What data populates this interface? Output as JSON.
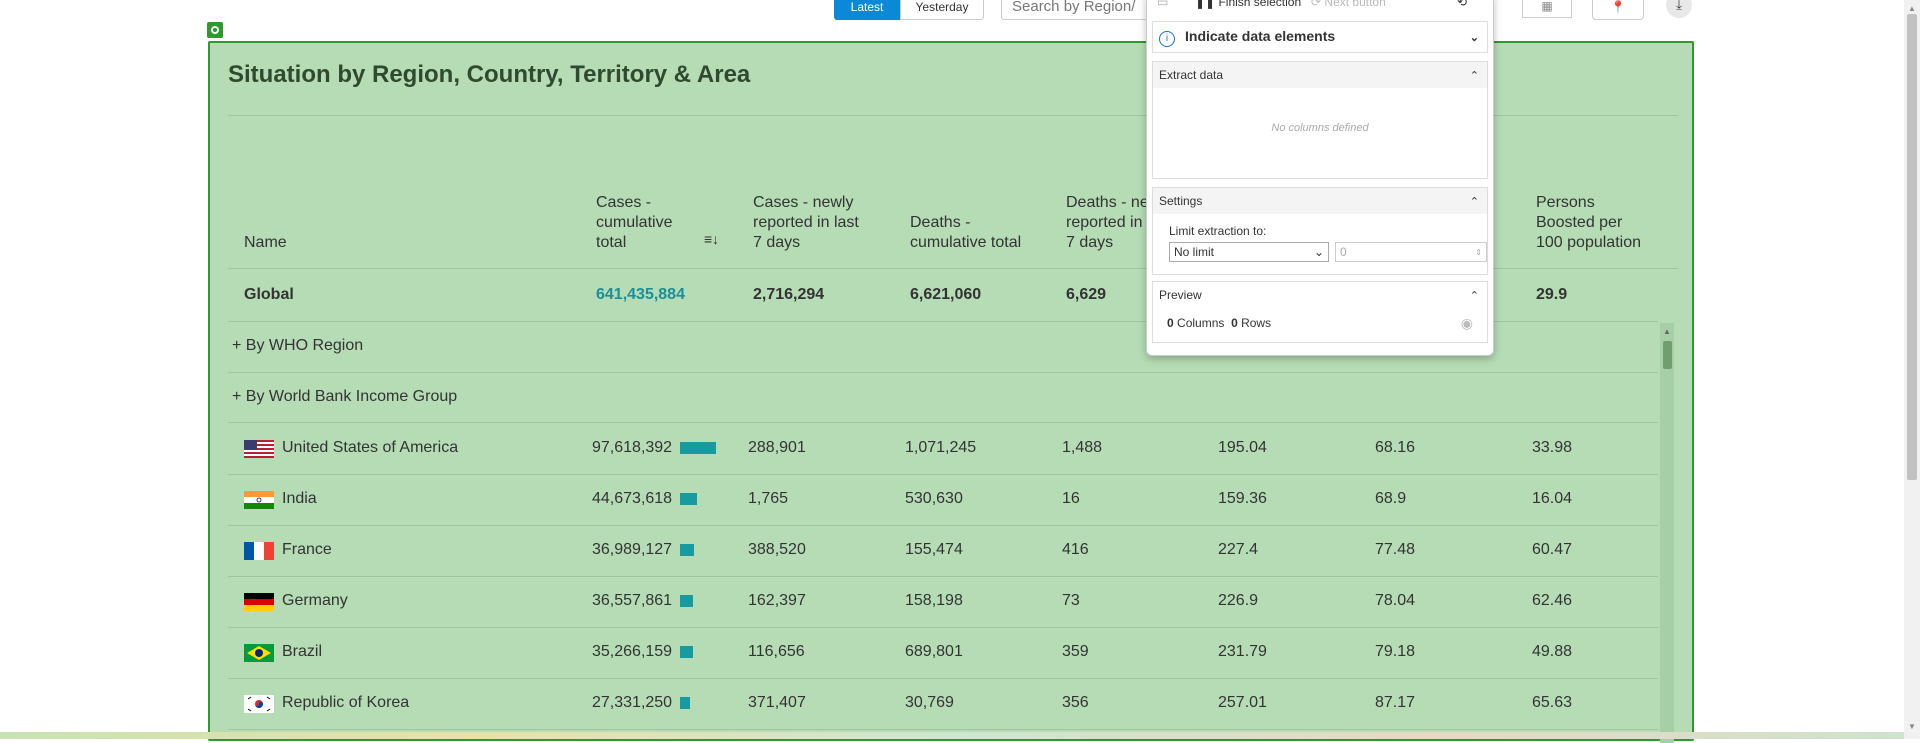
{
  "top_controls": {
    "latest_label": "Latest",
    "yesterday_label": "Yesterday",
    "search_placeholder": "Search by Region/"
  },
  "panel": {
    "title": "Situation by Region, Country, Territory & Area",
    "headers": {
      "name": "Name",
      "cases_total": [
        "Cases -",
        "cumulative",
        "total"
      ],
      "cases_new": [
        "Cases - newly",
        "reported in last",
        "7 days"
      ],
      "deaths_total": [
        "Deaths -",
        "cumulative total"
      ],
      "deaths_new": [
        "Deaths - ne",
        "reported in",
        "7 days"
      ],
      "boosted": [
        "Persons",
        "Boosted per",
        "100 population"
      ]
    },
    "global_row": {
      "name": "Global",
      "cases_total": "641,435,884",
      "cases_new": "2,716,294",
      "deaths_total": "6,621,060",
      "deaths_new": "6,629",
      "boosted": "29.9"
    },
    "groups": [
      "+ By WHO Region",
      "+ By World Bank Income Group"
    ],
    "countries": [
      {
        "name": "United States of America",
        "cases_total": "97,618,392",
        "bar": 1.0,
        "cases_new": "288,901",
        "deaths_total": "1,071,245",
        "deaths_new": "1,488",
        "col6": "195.04",
        "col7": "68.16",
        "boosted": "33.98"
      },
      {
        "name": "India",
        "cases_total": "44,673,618",
        "bar": 0.46,
        "cases_new": "1,765",
        "deaths_total": "530,630",
        "deaths_new": "16",
        "col6": "159.36",
        "col7": "68.9",
        "boosted": "16.04"
      },
      {
        "name": "France",
        "cases_total": "36,989,127",
        "bar": 0.38,
        "cases_new": "388,520",
        "deaths_total": "155,474",
        "deaths_new": "416",
        "col6": "227.4",
        "col7": "77.48",
        "boosted": "60.47"
      },
      {
        "name": "Germany",
        "cases_total": "36,557,861",
        "bar": 0.37,
        "cases_new": "162,397",
        "deaths_total": "158,198",
        "deaths_new": "73",
        "col6": "226.9",
        "col7": "78.04",
        "boosted": "62.46"
      },
      {
        "name": "Brazil",
        "cases_total": "35,266,159",
        "bar": 0.36,
        "cases_new": "116,656",
        "deaths_total": "689,801",
        "deaths_new": "359",
        "col6": "231.79",
        "col7": "79.18",
        "boosted": "49.88"
      },
      {
        "name": "Republic of Korea",
        "cases_total": "27,331,250",
        "bar": 0.28,
        "cases_new": "371,407",
        "deaths_total": "30,769",
        "deaths_new": "356",
        "col6": "257.01",
        "col7": "87.17",
        "boosted": "65.63"
      }
    ]
  },
  "popup": {
    "finish_label": "Finish selection",
    "next_label": "Next button",
    "indicate_label": "Indicate data elements",
    "extract_label": "Extract data",
    "no_columns": "No columns defined",
    "settings_label": "Settings",
    "limit_label": "Limit extraction to:",
    "limit_value": "No limit",
    "limit_number": "0",
    "preview_label": "Preview",
    "columns_count": "0",
    "columns_word": "Columns",
    "rows_count": "0",
    "rows_word": "Rows"
  },
  "colors": {
    "panel_bg": "#b5dcb5",
    "panel_border": "#2e9a2e",
    "bar": "#179aa0",
    "link": "#1a8f9a",
    "accent_blue": "#0a8ad6"
  }
}
